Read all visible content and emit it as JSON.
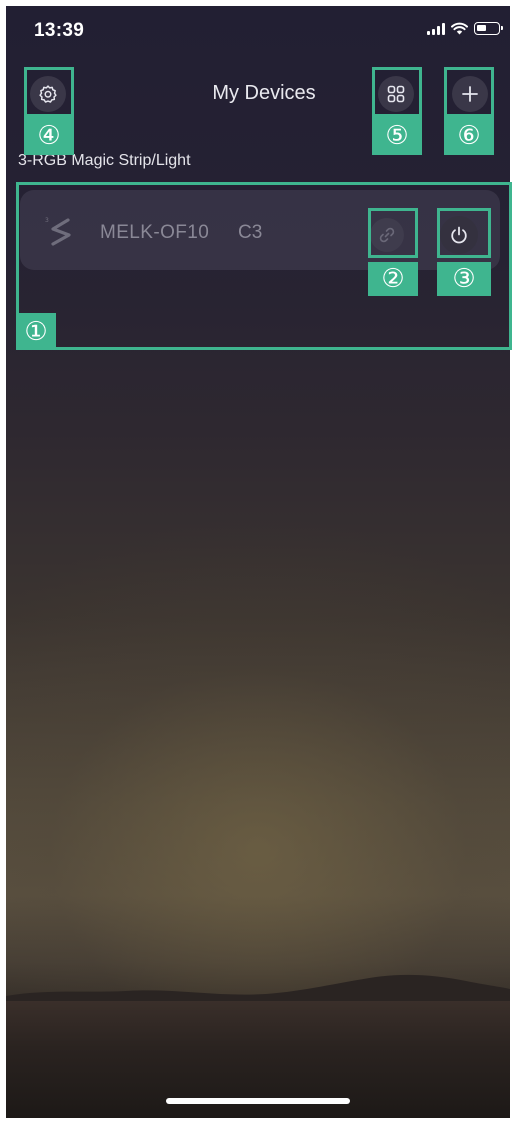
{
  "status_bar": {
    "time": "13:39"
  },
  "header": {
    "title": "My Devices",
    "settings_icon": "gear-icon",
    "grid_icon": "grid-icon",
    "add_icon": "plus-icon"
  },
  "section": {
    "label": "3-RGB Magic Strip/Light"
  },
  "device": {
    "name": "MELK-OF10",
    "code": "C3",
    "icon": "light-strip-icon",
    "link_icon": "link-icon",
    "power_icon": "power-icon"
  },
  "annotations": {
    "a1": "①",
    "a2": "②",
    "a3": "③",
    "a4": "④",
    "a5": "⑤",
    "a6": "⑥"
  },
  "colors": {
    "annotation": "#3fb58f",
    "button_bg": "#3a3748",
    "card_bg": "#46425480"
  }
}
